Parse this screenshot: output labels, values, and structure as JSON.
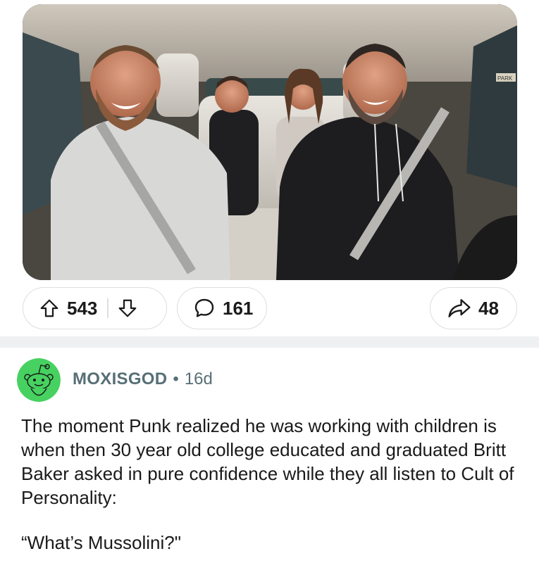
{
  "post": {
    "image_alt": "photo",
    "image_sign_text": "PARK"
  },
  "actions": {
    "upvote_count": "543",
    "comment_count": "161",
    "share_count": "48"
  },
  "comment": {
    "author": "MOXISGOD",
    "separator": "•",
    "age": "16d",
    "body_paragraphs": [
      "The moment Punk realized he was working with children is when then 30 year old college educated and graduated Britt Baker asked in pure confidence while they all listen to Cult of Personality:",
      "“What’s Mussolini?\"",
      ""
    ]
  },
  "colors": {
    "avatar_bg": "#46d160",
    "meta_text": "#576f76",
    "separator_bg": "#eff0f2",
    "pill_border": "#dcdee0"
  },
  "icons": [
    "upvote-arrow-icon",
    "downvote-arrow-icon",
    "comment-bubble-icon",
    "share-arrow-icon",
    "snoo-avatar-icon"
  ]
}
